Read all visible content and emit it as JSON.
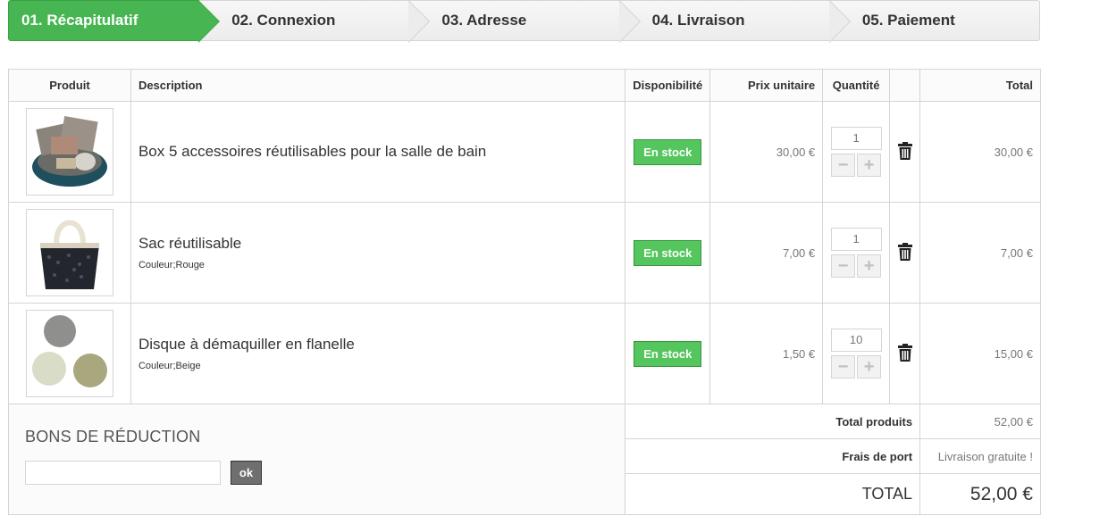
{
  "steps": [
    {
      "label": "01. Récapitulatif",
      "active": true
    },
    {
      "label": "02. Connexion",
      "active": false
    },
    {
      "label": "03. Adresse",
      "active": false
    },
    {
      "label": "04. Livraison",
      "active": false
    },
    {
      "label": "05. Paiement",
      "active": false
    }
  ],
  "table": {
    "headers": {
      "product": "Produit",
      "description": "Description",
      "availability": "Disponibilité",
      "unit_price": "Prix unitaire",
      "quantity": "Quantité",
      "total": "Total"
    },
    "rows": [
      {
        "name": "Box 5 accessoires réutilisables pour la salle de bain",
        "attr": "",
        "stock": "En stock",
        "unit_price": "30,00 €",
        "qty": "1",
        "total": "30,00 €",
        "image": "bathroom-accessories-box"
      },
      {
        "name": "Sac réutilisable",
        "attr": "Couleur;Rouge",
        "stock": "En stock",
        "unit_price": "7,00 €",
        "qty": "1",
        "total": "7,00 €",
        "image": "reusable-bag"
      },
      {
        "name": "Disque à démaquiller en flanelle",
        "attr": "Couleur;Beige",
        "stock": "En stock",
        "unit_price": "1,50 €",
        "qty": "10",
        "total": "15,00 €",
        "image": "flannel-pads"
      }
    ]
  },
  "voucher": {
    "title": "BONS DE RÉDUCTION",
    "input_value": "",
    "button_label": "ok"
  },
  "summary": {
    "total_products_label": "Total produits",
    "total_products_value": "52,00 €",
    "shipping_label": "Frais de port",
    "shipping_value": "Livraison gratuite !",
    "total_label": "TOTAL",
    "total_value": "52,00 €"
  },
  "colors": {
    "active_step": "#47b652",
    "stock_badge": "#55c65e"
  }
}
